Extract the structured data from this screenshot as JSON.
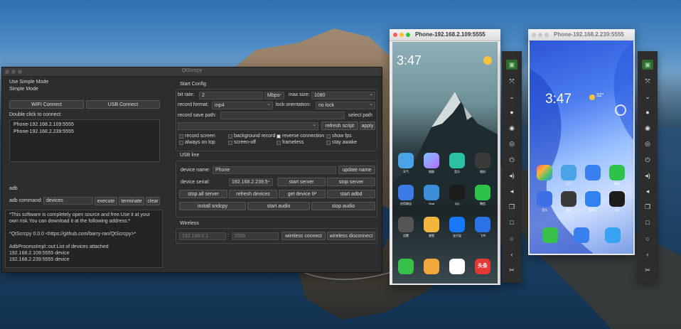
{
  "qtscrcpy": {
    "window_title": "QtScrcpy",
    "left": {
      "use_simple_mode": "Use Simple Mode",
      "simple_mode": "Simple Mode",
      "wifi_connect": "WIFI Connect",
      "usb_connect": "USB Connect",
      "double_click_hint": "Double click to connect:",
      "devices": [
        "Phone-192.168.2.109:5555",
        "Phone-192.168.2.239:5555"
      ],
      "adb_section": "adb",
      "adb_command_label": "adb command:",
      "adb_command_value": "devices",
      "execute": "execute",
      "terminate": "terminate",
      "clear": "clear",
      "console_lines": [
        "*This software is completely open source and free.Use it at your",
        "own risk.You can download it at the following address:*",
        "",
        "*QtScrcpy 0.0.0 <https://github.com/barry-ran/QtScrcpy>*",
        "",
        "AdbProcessImpl::out:List of devices attached",
        "192.168.2.109:5555          device",
        "192.168.2.239:5555          device"
      ]
    },
    "start_config": {
      "title": "Start Config",
      "bit_rate_label": "bit rate:",
      "bit_rate_value": "2",
      "bit_rate_unit": "Mbps",
      "max_size_label": "max size:",
      "max_size_value": "1080",
      "record_format_label": "record format:",
      "record_format_value": "mp4",
      "lock_orientation_label": "lock orientation:",
      "lock_orientation_value": "no lock",
      "record_save_path_label": "record save path:",
      "record_save_path_value": "",
      "select_path": "select path",
      "script_value": "",
      "refresh_script": "refresh script",
      "apply": "apply",
      "options": [
        {
          "label": "record screen",
          "checked": false
        },
        {
          "label": "background record",
          "checked": false
        },
        {
          "label": "reverse connection",
          "checked": true
        },
        {
          "label": "show fps",
          "checked": false
        },
        {
          "label": "always on top",
          "checked": false
        },
        {
          "label": "screen-off",
          "checked": false
        },
        {
          "label": "frameless",
          "checked": false
        },
        {
          "label": "stay awake",
          "checked": false
        }
      ]
    },
    "usb_line": {
      "title": "USB line",
      "device_name_label": "device name:",
      "device_name_value": "Phone",
      "update_name": "update name",
      "device_serial_label": "device serial:",
      "device_serial_value": "192.168.2.239:5",
      "start_server": "start server",
      "stop_server": "stop server",
      "stop_all_server": "stop all server",
      "refresh_devices": "refresh devices",
      "get_device_ip": "get device IP",
      "start_adbd": "start adbd",
      "install_sndcpy": "install sndcpy",
      "start_audio": "start audio",
      "stop_audio": "stop audio"
    },
    "wireless": {
      "title": "Wireless",
      "ip_placeholder": "192.168.0.1",
      "separator": ":",
      "port_placeholder": "5555",
      "wireless_connect": "wireless connect",
      "wireless_disconnect": "wireless disconnect"
    }
  },
  "phone1": {
    "window_title": "Phone-192.168.2.109:5555",
    "clock": "3:47",
    "apps_row1": [
      "天气",
      "相册",
      "音乐",
      "相机"
    ],
    "apps_row2": [
      "应用商店",
      "Seal",
      "QQ",
      "微信"
    ],
    "apps_row3": [
      "设置",
      "便签",
      "支付宝",
      "飞书"
    ],
    "dock_text": "头条"
  },
  "phone2": {
    "window_title": "Phone-192.168.2.239:5555",
    "clock": "3:47",
    "temperature": "32°",
    "apps_row1": [
      "",
      "天气",
      "",
      "微信"
    ],
    "apps_row2": [
      "音乐",
      "相机",
      "联系人",
      "QQ"
    ]
  },
  "toolbar_icons": [
    "power-on-icon",
    "fullscreen-icon",
    "collapse-icon",
    "dot-icon",
    "eye-icon",
    "eye-off-icon",
    "power-icon",
    "volume-up-icon",
    "volume-down-icon",
    "copy-icon",
    "square-icon",
    "circle-icon",
    "back-icon",
    "screenshot-icon"
  ],
  "colors": {
    "window_bg": "#2d2d2d",
    "toolbar_active": "#2f6a2f"
  }
}
